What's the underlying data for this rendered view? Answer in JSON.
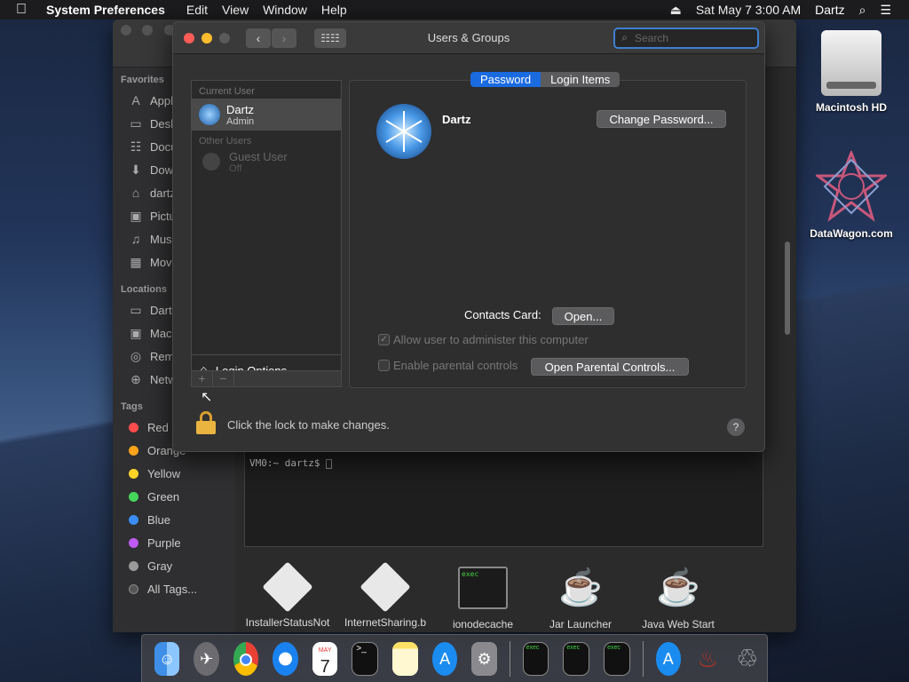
{
  "menubar": {
    "apple": "",
    "app_name": "System Preferences",
    "items": [
      "Edit",
      "View",
      "Window",
      "Help"
    ],
    "datetime": "Sat May 7  3:00 AM",
    "user": "Dartz"
  },
  "desktop": {
    "icons": [
      {
        "label": "Macintosh HD"
      },
      {
        "label": "DataWagon.com"
      }
    ]
  },
  "finder": {
    "favorites_header": "Favorites",
    "favorites": [
      "Appl",
      "Desk",
      "Docu",
      "Dow",
      "dartz",
      "Pictu",
      "Musi",
      "Movi"
    ],
    "locations_header": "Locations",
    "locations": [
      "Dartz",
      "Mac",
      "Rem",
      "Netw"
    ],
    "tags_header": "Tags",
    "tags": [
      {
        "name": "Red",
        "color": "#ff4b4b"
      },
      {
        "name": "Orange",
        "color": "#ffa31a"
      },
      {
        "name": "Yellow",
        "color": "#ffd426"
      },
      {
        "name": "Green",
        "color": "#45d65a"
      },
      {
        "name": "Blue",
        "color": "#3a8df5"
      },
      {
        "name": "Purple",
        "color": "#bf5af2"
      },
      {
        "name": "Gray",
        "color": "#9a9a9a"
      },
      {
        "name": "All Tags...",
        "color": "#555"
      }
    ],
    "files": [
      "InstallerStatusNot",
      "InternetSharing.b",
      "ionodecache",
      "Jar Launcher",
      "Java Web Start"
    ],
    "exec_label": "exec"
  },
  "terminal": {
    "prompt": "VM0:~ dartz$ "
  },
  "prefs": {
    "title": "Users & Groups",
    "search_placeholder": "Search",
    "current_user_header": "Current User",
    "current_user": {
      "name": "Dartz",
      "role": "Admin"
    },
    "other_users_header": "Other Users",
    "guest": {
      "name": "Guest User",
      "status": "Off"
    },
    "login_options": "Login Options",
    "add": "+",
    "remove": "−",
    "tabs": [
      {
        "label": "Password",
        "active": true
      },
      {
        "label": "Login Items",
        "active": false
      }
    ],
    "user_display_name": "Dartz",
    "change_password": "Change Password...",
    "contacts_card_label": "Contacts Card:",
    "open_btn": "Open...",
    "allow_admin": "Allow user to administer this computer",
    "allow_admin_checked": true,
    "parental": "Enable parental controls",
    "open_parental": "Open Parental Controls...",
    "lock_text": "Click the lock to make changes.",
    "help": "?"
  },
  "dock": {
    "apps": [
      "Finder",
      "Launchpad",
      "Chrome",
      "Safari",
      "Calendar",
      "Terminal",
      "Notes",
      "App Store",
      "System Preferences",
      "exec",
      "exec",
      "exec",
      "Downloads",
      "Wine",
      "Trash"
    ],
    "calendar_month": "MAY",
    "calendar_day": "7"
  }
}
